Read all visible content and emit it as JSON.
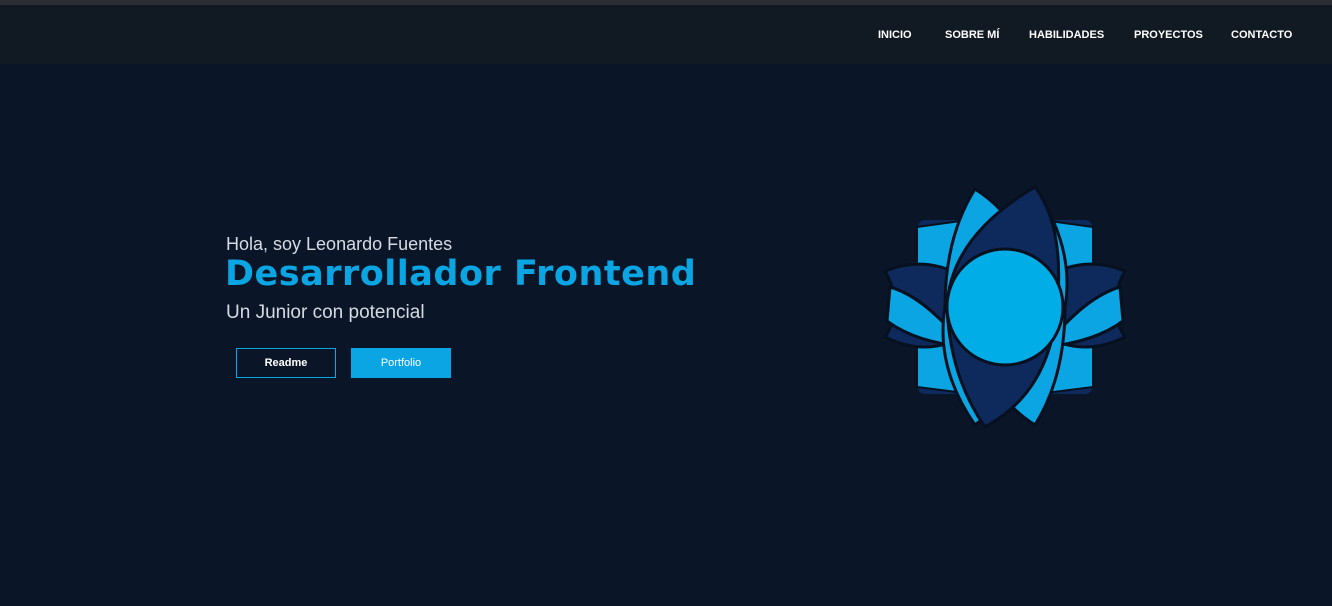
{
  "nav": {
    "items": [
      {
        "label": "INICIO"
      },
      {
        "label": "SOBRE MÍ"
      },
      {
        "label": "HABILIDADES"
      },
      {
        "label": "PROYECTOS"
      },
      {
        "label": "CONTACTO"
      }
    ]
  },
  "hero": {
    "greeting": "Hola, soy Leonardo Fuentes",
    "role": "Desarrollador Frontend",
    "subtitle": "Un Junior con potencial",
    "buttons": {
      "readme_label": "Readme",
      "portfolio_label": "Portfolio"
    }
  },
  "colors": {
    "background": "#0a1628",
    "navbar": "#111923",
    "accent": "#0aa5e2",
    "petal_dark": "#0e2a5c",
    "petal_light": "#0aa5e2"
  },
  "icons": {
    "logo": "flower-logo-icon"
  }
}
